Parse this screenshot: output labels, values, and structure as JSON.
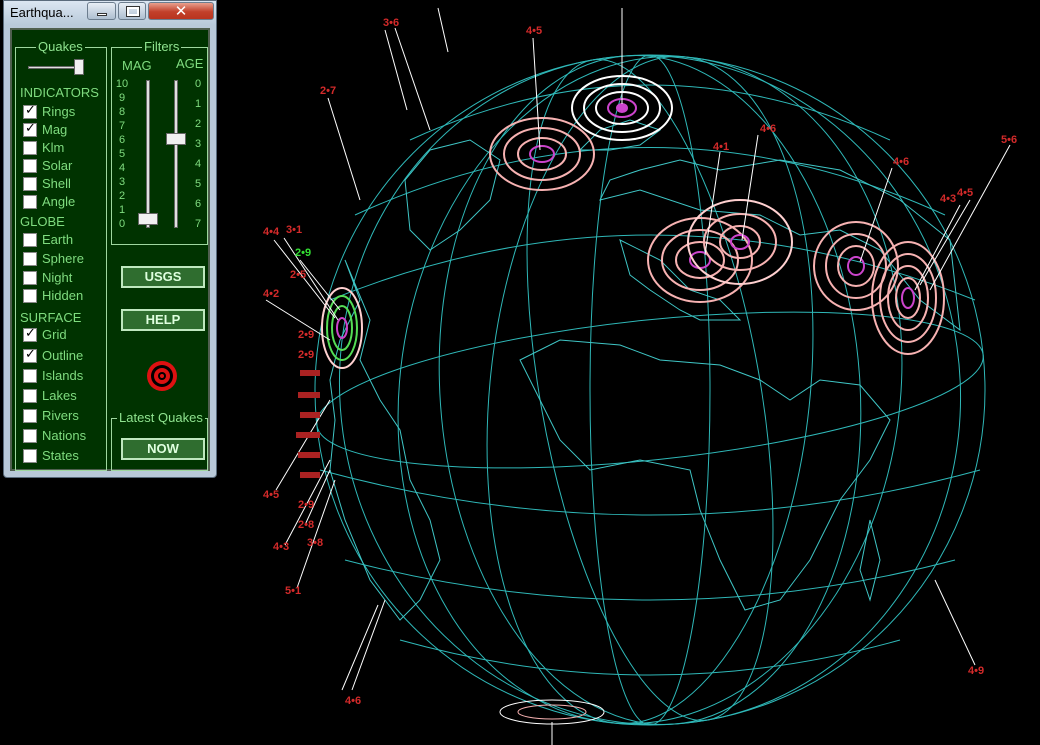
{
  "window": {
    "title": "Earthqua..."
  },
  "window_buttons": {
    "minimize": "minimize",
    "maximize": "maximize",
    "close_glyph": "✕"
  },
  "quakes_group": {
    "legend": "Quakes"
  },
  "indicators": {
    "heading": "INDICATORS",
    "items": [
      {
        "label": "Rings",
        "checked": true
      },
      {
        "label": "Mag",
        "checked": true
      },
      {
        "label": "Klm",
        "checked": false
      },
      {
        "label": "Solar",
        "checked": false
      },
      {
        "label": "Shell",
        "checked": false
      },
      {
        "label": "Angle",
        "checked": false
      }
    ]
  },
  "globe_section": {
    "heading": "GLOBE",
    "items": [
      {
        "label": "Earth",
        "checked": false
      },
      {
        "label": "Sphere",
        "checked": false
      },
      {
        "label": "Night",
        "checked": false
      },
      {
        "label": "Hidden",
        "checked": false
      }
    ]
  },
  "surface": {
    "heading": "SURFACE",
    "items": [
      {
        "label": "Grid",
        "checked": true
      },
      {
        "label": "Outline",
        "checked": true
      },
      {
        "label": "Islands",
        "checked": false
      },
      {
        "label": "Lakes",
        "checked": false
      },
      {
        "label": "Rivers",
        "checked": false
      },
      {
        "label": "Nations",
        "checked": false
      },
      {
        "label": "States",
        "checked": false
      }
    ]
  },
  "filters": {
    "legend": "Filters",
    "mag_label": "MAG",
    "age_label": "AGE",
    "mag_scale": [
      "10",
      "9",
      "8",
      "7",
      "6",
      "5",
      "4",
      "3",
      "2",
      "1",
      "0"
    ],
    "age_scale": [
      "0",
      "1",
      "2",
      "3",
      "4",
      "5",
      "6",
      "7"
    ],
    "mag_value": 0,
    "age_value": 3
  },
  "buttons": {
    "usgs": "USGS",
    "help": "HELP",
    "now": "NOW"
  },
  "latest_group": {
    "legend": "Latest Quakes"
  },
  "colors": {
    "panel_bg": "#003300",
    "grid": "#2fb8b8",
    "label_red": "#d22a2a",
    "label_green": "#33dd33",
    "ring_pink": "#f7b2b2",
    "ring_white": "#ffffff",
    "ring_purple": "#cc44cc"
  },
  "quake_labels": [
    {
      "text": "3•6",
      "color": "red"
    },
    {
      "text": "4•5",
      "color": "red"
    },
    {
      "text": "2•7",
      "color": "red"
    },
    {
      "text": "4•6",
      "color": "red"
    },
    {
      "text": "4•1",
      "color": "red"
    },
    {
      "text": "4•6",
      "color": "red"
    },
    {
      "text": "5•6",
      "color": "red"
    },
    {
      "text": "4•5",
      "color": "red"
    },
    {
      "text": "4•3",
      "color": "red"
    },
    {
      "text": "4•4",
      "color": "red"
    },
    {
      "text": "3•1",
      "color": "red"
    },
    {
      "text": "2•9",
      "color": "green"
    },
    {
      "text": "2•5",
      "color": "red"
    },
    {
      "text": "4•2",
      "color": "red"
    },
    {
      "text": "2•9",
      "color": "red"
    },
    {
      "text": "2•9",
      "color": "red"
    },
    {
      "text": "4•5",
      "color": "red"
    },
    {
      "text": "2•9",
      "color": "red"
    },
    {
      "text": "2•8",
      "color": "red"
    },
    {
      "text": "4•3",
      "color": "red"
    },
    {
      "text": "3•8",
      "color": "red"
    },
    {
      "text": "5•1",
      "color": "red"
    },
    {
      "text": "4•6",
      "color": "red"
    },
    {
      "text": "4•9",
      "color": "red"
    }
  ]
}
